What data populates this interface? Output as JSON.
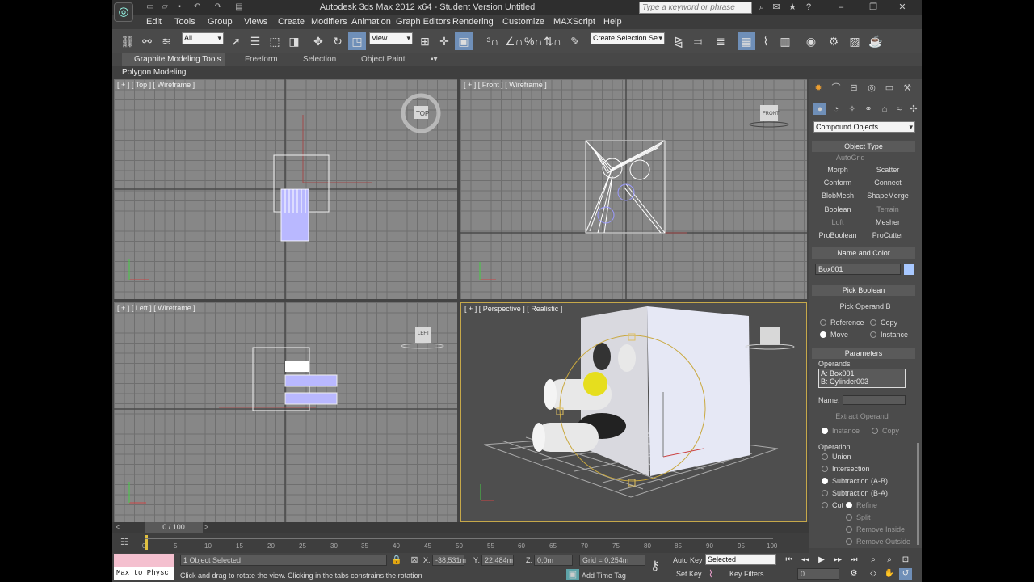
{
  "app": {
    "title": "Autodesk 3ds Max  2012 x64  - Student Version   Untitled",
    "search_placeholder": "Type a keyword or phrase"
  },
  "menu": [
    "Edit",
    "Tools",
    "Group",
    "Views",
    "Create",
    "Modifiers",
    "Animation",
    "Graph Editors",
    "Rendering",
    "Customize",
    "MAXScript",
    "Help"
  ],
  "toolbar": {
    "selection_filter": "All",
    "reference_coord": "View",
    "named_selection_placeholder": "Create Selection Se"
  },
  "ribbon": {
    "tabs": [
      "Graphite Modeling Tools",
      "Freeform",
      "Selection",
      "Object Paint"
    ],
    "subtab": "Polygon Modeling"
  },
  "viewports": {
    "top": "[ + ] [ Top ] [ Wireframe ]",
    "front": "[ + ] [ Front ] [ Wireframe ]",
    "left": "[ + ] [ Left ] [ Wireframe ]",
    "perspective": "[ + ] [ Perspective ] [ Realistic ]",
    "cube_top": "TOP",
    "cube_front": "FRONT",
    "cube_left": "LEFT"
  },
  "command_panel": {
    "category": "Compound Objects",
    "object_type_title": "Object Type",
    "autogrid": "AutoGrid",
    "buttons": [
      "Morph",
      "Scatter",
      "Conform",
      "Connect",
      "BlobMesh",
      "ShapeMerge",
      "Boolean",
      "Terrain",
      "Loft",
      "Mesher",
      "ProBoolean",
      "ProCutter"
    ],
    "name_color_title": "Name and Color",
    "object_name": "Box001",
    "object_color": "#a8c8ff",
    "pick_boolean_title": "Pick Boolean",
    "pick_operand": "Pick Operand B",
    "reference": "Reference",
    "copy": "Copy",
    "move": "Move",
    "instance": "Instance",
    "parameters_title": "Parameters",
    "operands_label": "Operands",
    "operands": [
      "A: Box001",
      "B: Cylinder003"
    ],
    "name_label": "Name:",
    "extract_operand": "Extract Operand",
    "instance2": "Instance",
    "copy2": "Copy",
    "operation_label": "Operation",
    "operations": [
      "Union",
      "Intersection",
      "Subtraction (A-B)",
      "Subtraction (B-A)"
    ],
    "cut": "Cut",
    "refine": "Refine",
    "split": "Split",
    "remove_inside": "Remove Inside",
    "remove_outside": "Remove Outside"
  },
  "timeline": {
    "frame_counter": "0 / 100",
    "ticks": [
      "0",
      "5",
      "10",
      "15",
      "20",
      "25",
      "30",
      "35",
      "40",
      "45",
      "50",
      "55",
      "60",
      "65",
      "70",
      "75",
      "80",
      "85",
      "90",
      "95",
      "100"
    ]
  },
  "status": {
    "maxscript": "Max to Physc",
    "selected": "1 Object Selected",
    "prompt": "Click and drag to rotate the view.  Clicking in the tabs constrains the rotation",
    "x_label": "X:",
    "x_value": "-38,531m",
    "y_label": "Y:",
    "y_value": "22,484m",
    "z_label": "Z:",
    "z_value": "0,0m",
    "grid": "Grid = 0,254m",
    "add_time_tag": "Add Time Tag",
    "auto_key": "Auto Key",
    "set_key": "Set Key",
    "key_mode": "Selected",
    "key_filters": "Key Filters...",
    "current_frame": "0"
  },
  "colors": {
    "accent_highlight": "#f4c0cf",
    "selection_blue": "#b9b8ff",
    "viewport_gray": "#878787"
  }
}
